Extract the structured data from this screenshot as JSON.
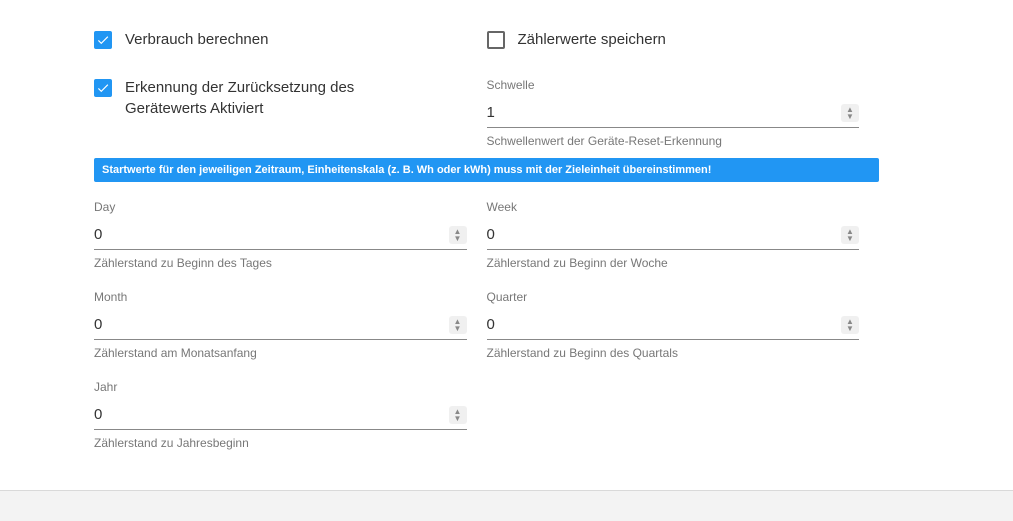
{
  "checkboxes": {
    "calcConsumption": {
      "label": "Verbrauch berechnen",
      "checked": true
    },
    "saveCounter": {
      "label": "Zählerwerte speichern",
      "checked": false
    },
    "resetDetect": {
      "label": "Erkennung der Zurücksetzung des Gerätewerts Aktiviert",
      "checked": true
    }
  },
  "threshold": {
    "label": "Schwelle",
    "value": "1",
    "help": "Schwellenwert der Geräte-Reset-Erkennung"
  },
  "banner": "Startwerte für den jeweiligen Zeitraum, Einheitenskala (z. B. Wh oder kWh) muss mit der Zieleinheit übereinstimmen!",
  "periods": {
    "day": {
      "label": "Day",
      "value": "0",
      "help": "Zählerstand zu Beginn des Tages"
    },
    "week": {
      "label": "Week",
      "value": "0",
      "help": "Zählerstand zu Beginn der Woche"
    },
    "month": {
      "label": "Month",
      "value": "0",
      "help": "Zählerstand am Monatsanfang"
    },
    "quarter": {
      "label": "Quarter",
      "value": "0",
      "help": "Zählerstand zu Beginn des Quartals"
    },
    "year": {
      "label": "Jahr",
      "value": "0",
      "help": "Zählerstand zu Jahresbeginn"
    }
  }
}
